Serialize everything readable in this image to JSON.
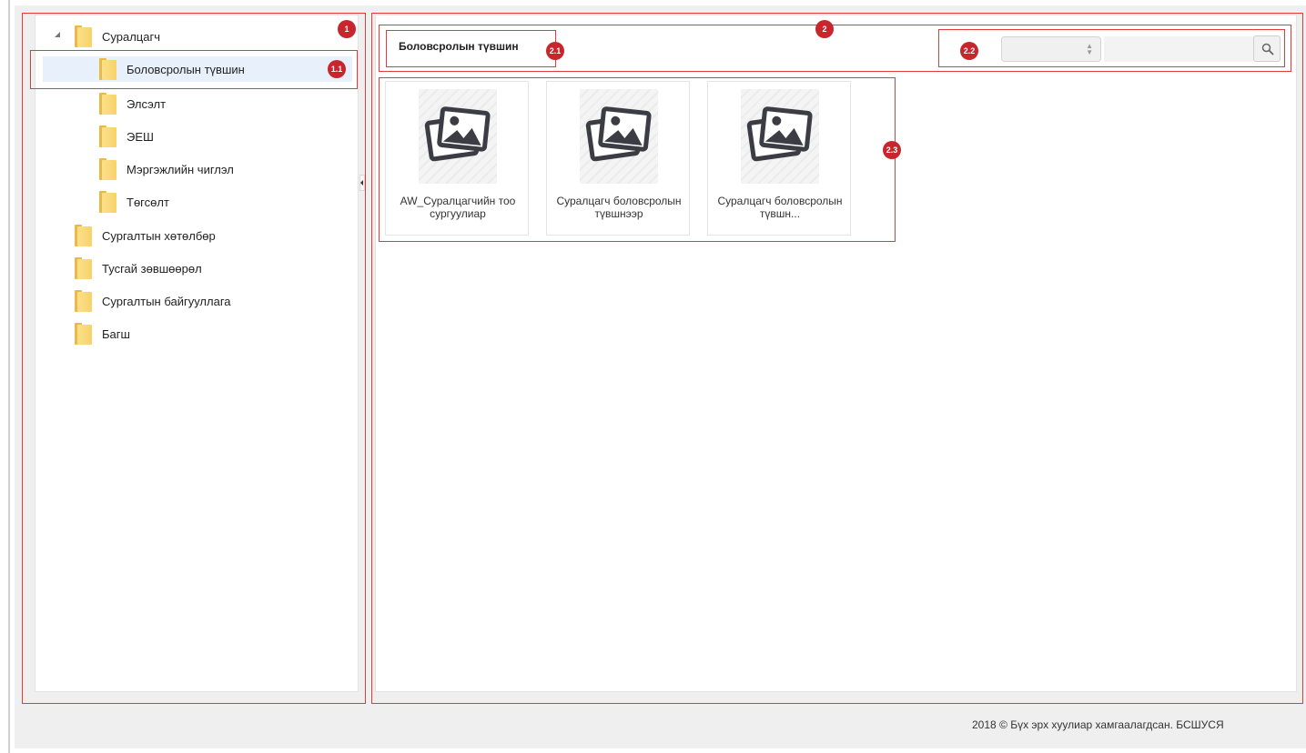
{
  "tree": {
    "root": {
      "label": "Суралцагч",
      "children": [
        {
          "label": "Боловсролын түвшин",
          "selected": true
        },
        {
          "label": "Элсэлт"
        },
        {
          "label": "ЭЕШ"
        },
        {
          "label": "Мэргэжлийн чиглэл"
        },
        {
          "label": "Төгсөлт"
        }
      ]
    },
    "siblings": [
      {
        "label": "Сургалтын хөтөлбөр"
      },
      {
        "label": "Тусгай зөвшөөрөл"
      },
      {
        "label": "Сургалтын байгууллага"
      },
      {
        "label": "Багш"
      }
    ]
  },
  "content": {
    "title": "Боловсролын түвшин",
    "filter": {
      "selected": ""
    },
    "search": {
      "value": "",
      "icon": "search-icon"
    },
    "tiles": [
      {
        "caption": "AW_Суралцагчийн тоо сургуулиар",
        "icon": "image-gallery-icon"
      },
      {
        "caption": "Суралцагч боловсролын түвшнээр",
        "icon": "image-gallery-icon"
      },
      {
        "caption": "Суралцагч боловсролын түвшн...",
        "icon": "image-gallery-icon"
      }
    ]
  },
  "annotations": {
    "b1": "1",
    "b1_1": "1.1",
    "b2": "2",
    "b2_1": "2.1",
    "b2_2": "2.2",
    "b2_3": "2.3"
  },
  "footer": {
    "text": "2018 © Бүх эрх хуулиар хамгаалагдсан. БСШУСЯ"
  },
  "colors": {
    "annotation": "#e23b3b",
    "badge": "#c8252c",
    "selected_row": "#e8f1fb",
    "folder": "#f8d26a"
  }
}
